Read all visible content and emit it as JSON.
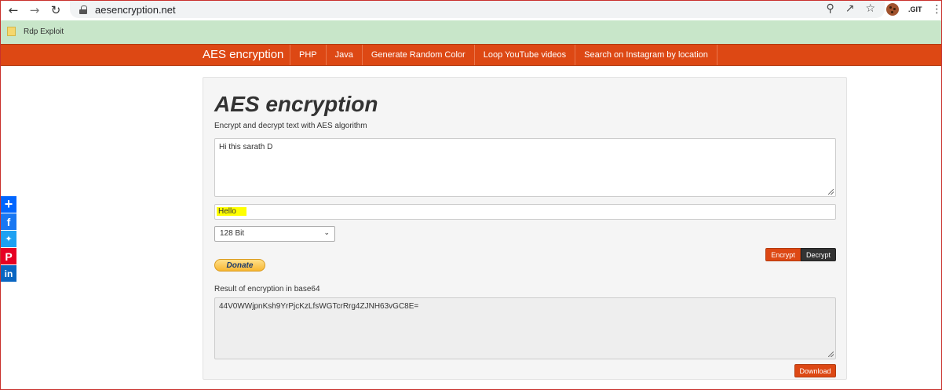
{
  "browser": {
    "url": "aesencryption.net",
    "back_icon": "arrow-left-icon",
    "forward_icon": "arrow-right-icon",
    "reload_icon": "reload-icon",
    "ext_git_label": ".GIT",
    "bookmark": "Rdp Exploit"
  },
  "nav": {
    "brand": "AES encryption",
    "links": [
      "PHP",
      "Java",
      "Generate Random Color",
      "Loop YouTube videos",
      "Search on Instagram by location"
    ]
  },
  "main": {
    "title": "AES encryption",
    "subtitle": "Encrypt and decrypt text with AES algorithm",
    "text_value": "Hi this sarath D",
    "key_value": "Hello",
    "key_size": "128 Bit",
    "donate_label": "Donate",
    "encrypt_label": "Encrypt",
    "decrypt_label": "Decrypt",
    "result_label": "Result of encryption in base64",
    "result_value": "44V0WWjpnKsh9YrPjcKzLfsWGTcrRrg4ZJNH63vGC8E=",
    "download_label": "Download"
  },
  "colors": {
    "accent": "#dd4814",
    "bookmarks_bar": "#c8e6c9",
    "highlight": "#ffff00"
  }
}
